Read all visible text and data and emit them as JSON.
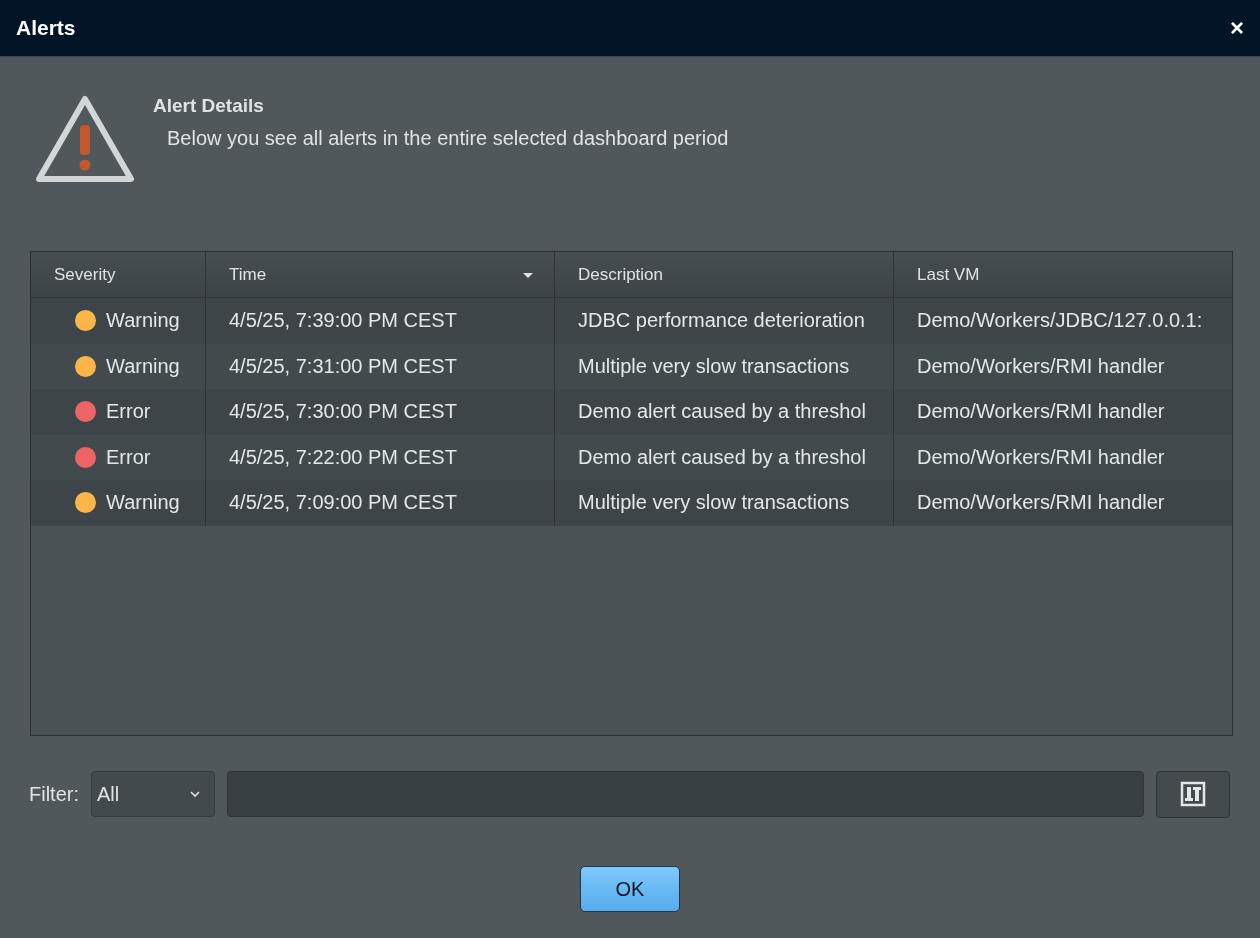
{
  "window": {
    "title": "Alerts",
    "close": "×"
  },
  "header": {
    "title": "Alert Details",
    "subtitle": "Below you see all alerts in the entire selected dashboard period"
  },
  "table": {
    "columns": [
      "Severity",
      "Time",
      "Description",
      "Last VM"
    ],
    "rows": [
      {
        "severity": "Warning",
        "color": "#fdb54a",
        "time": "4/5/25, 7:39:00 PM CEST",
        "description": "JDBC performance deterioration",
        "last_vm": "Demo/Workers/JDBC/127.0.0.1:"
      },
      {
        "severity": "Warning",
        "color": "#fdb54a",
        "time": "4/5/25, 7:31:00 PM CEST",
        "description": "Multiple very slow transactions",
        "last_vm": "Demo/Workers/RMI handler"
      },
      {
        "severity": "Error",
        "color": "#ec6464",
        "time": "4/5/25, 7:30:00 PM CEST",
        "description": "Demo alert caused by a threshol",
        "last_vm": "Demo/Workers/RMI handler"
      },
      {
        "severity": "Error",
        "color": "#ec6464",
        "time": "4/5/25, 7:22:00 PM CEST",
        "description": "Demo alert caused by a threshol",
        "last_vm": "Demo/Workers/RMI handler"
      },
      {
        "severity": "Warning",
        "color": "#fdb54a",
        "time": "4/5/25, 7:09:00 PM CEST",
        "description": "Multiple very slow transactions",
        "last_vm": "Demo/Workers/RMI handler"
      }
    ]
  },
  "filter": {
    "label": "Filter:",
    "value": "All"
  },
  "buttons": [
    "OK"
  ]
}
